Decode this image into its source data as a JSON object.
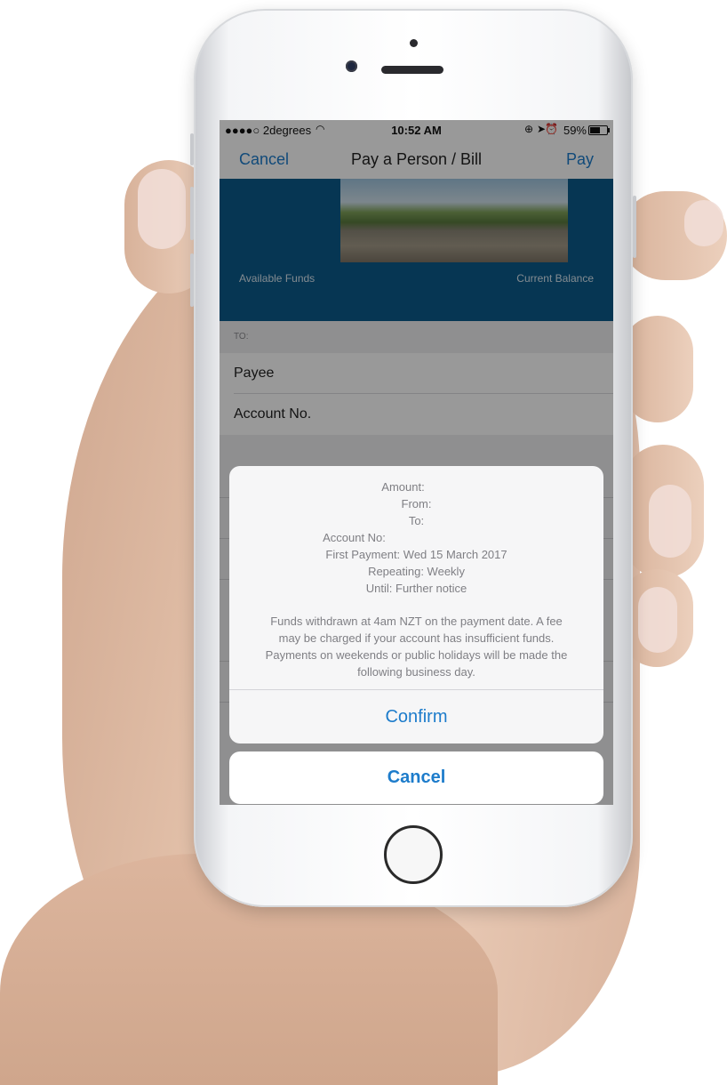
{
  "status_bar": {
    "carrier": "●●●●○ 2degrees",
    "time": "10:52 AM",
    "battery": "59%",
    "wifi_icon": "wifi-icon",
    "battery_icon": "battery-icon"
  },
  "nav": {
    "cancel": "Cancel",
    "title": "Pay a Person / Bill",
    "pay": "Pay"
  },
  "hero": {
    "available_funds": "Available Funds",
    "current_balance": "Current Balance"
  },
  "form": {
    "to_header": "TO:",
    "payee": "Payee",
    "account_no": "Account No."
  },
  "sheet": {
    "lines": [
      "Amount:",
      "From:",
      "To:",
      "Account No:",
      "First Payment: Wed 15 March 2017",
      "Repeating: Weekly",
      "Until: Further notice"
    ],
    "notice": [
      "Funds withdrawn at 4am NZT on the payment date. A fee",
      "may be charged if your account has insufficient funds.",
      "Payments on weekends or public holidays will be made the",
      "following business day."
    ],
    "confirm": "Confirm",
    "cancel": "Cancel"
  },
  "colors": {
    "accent": "#1d7ccb",
    "hero_bg": "#0b5a8a"
  }
}
